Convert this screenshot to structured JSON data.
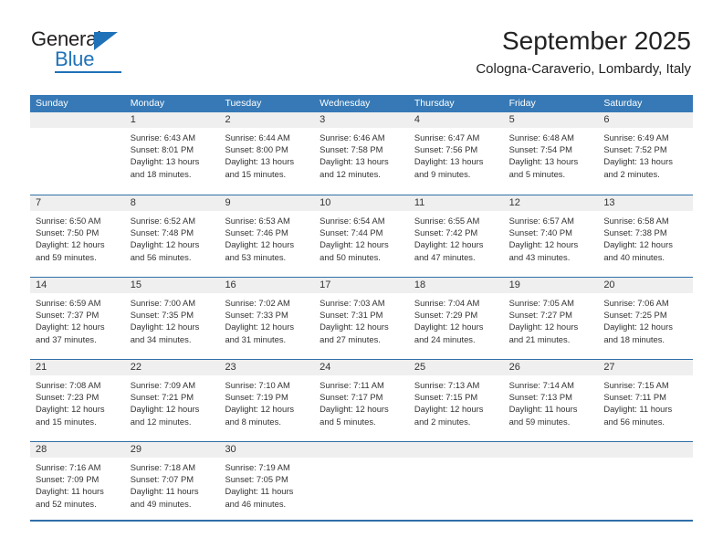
{
  "branding": {
    "logo_text_1": "General",
    "logo_text_2": "Blue",
    "accent_color": "#1f72b8"
  },
  "header": {
    "month_title": "September 2025",
    "location": "Cologna-Caraverio, Lombardy, Italy",
    "header_bg_color": "#3679b6",
    "day_band_color": "#efefef"
  },
  "weekdays": [
    "Sunday",
    "Monday",
    "Tuesday",
    "Wednesday",
    "Thursday",
    "Friday",
    "Saturday"
  ],
  "weeks": [
    [
      {
        "day": "",
        "lines": []
      },
      {
        "day": "1",
        "lines": [
          "Sunrise: 6:43 AM",
          "Sunset: 8:01 PM",
          "Daylight: 13 hours",
          "and 18 minutes."
        ]
      },
      {
        "day": "2",
        "lines": [
          "Sunrise: 6:44 AM",
          "Sunset: 8:00 PM",
          "Daylight: 13 hours",
          "and 15 minutes."
        ]
      },
      {
        "day": "3",
        "lines": [
          "Sunrise: 6:46 AM",
          "Sunset: 7:58 PM",
          "Daylight: 13 hours",
          "and 12 minutes."
        ]
      },
      {
        "day": "4",
        "lines": [
          "Sunrise: 6:47 AM",
          "Sunset: 7:56 PM",
          "Daylight: 13 hours",
          "and 9 minutes."
        ]
      },
      {
        "day": "5",
        "lines": [
          "Sunrise: 6:48 AM",
          "Sunset: 7:54 PM",
          "Daylight: 13 hours",
          "and 5 minutes."
        ]
      },
      {
        "day": "6",
        "lines": [
          "Sunrise: 6:49 AM",
          "Sunset: 7:52 PM",
          "Daylight: 13 hours",
          "and 2 minutes."
        ]
      }
    ],
    [
      {
        "day": "7",
        "lines": [
          "Sunrise: 6:50 AM",
          "Sunset: 7:50 PM",
          "Daylight: 12 hours",
          "and 59 minutes."
        ]
      },
      {
        "day": "8",
        "lines": [
          "Sunrise: 6:52 AM",
          "Sunset: 7:48 PM",
          "Daylight: 12 hours",
          "and 56 minutes."
        ]
      },
      {
        "day": "9",
        "lines": [
          "Sunrise: 6:53 AM",
          "Sunset: 7:46 PM",
          "Daylight: 12 hours",
          "and 53 minutes."
        ]
      },
      {
        "day": "10",
        "lines": [
          "Sunrise: 6:54 AM",
          "Sunset: 7:44 PM",
          "Daylight: 12 hours",
          "and 50 minutes."
        ]
      },
      {
        "day": "11",
        "lines": [
          "Sunrise: 6:55 AM",
          "Sunset: 7:42 PM",
          "Daylight: 12 hours",
          "and 47 minutes."
        ]
      },
      {
        "day": "12",
        "lines": [
          "Sunrise: 6:57 AM",
          "Sunset: 7:40 PM",
          "Daylight: 12 hours",
          "and 43 minutes."
        ]
      },
      {
        "day": "13",
        "lines": [
          "Sunrise: 6:58 AM",
          "Sunset: 7:38 PM",
          "Daylight: 12 hours",
          "and 40 minutes."
        ]
      }
    ],
    [
      {
        "day": "14",
        "lines": [
          "Sunrise: 6:59 AM",
          "Sunset: 7:37 PM",
          "Daylight: 12 hours",
          "and 37 minutes."
        ]
      },
      {
        "day": "15",
        "lines": [
          "Sunrise: 7:00 AM",
          "Sunset: 7:35 PM",
          "Daylight: 12 hours",
          "and 34 minutes."
        ]
      },
      {
        "day": "16",
        "lines": [
          "Sunrise: 7:02 AM",
          "Sunset: 7:33 PM",
          "Daylight: 12 hours",
          "and 31 minutes."
        ]
      },
      {
        "day": "17",
        "lines": [
          "Sunrise: 7:03 AM",
          "Sunset: 7:31 PM",
          "Daylight: 12 hours",
          "and 27 minutes."
        ]
      },
      {
        "day": "18",
        "lines": [
          "Sunrise: 7:04 AM",
          "Sunset: 7:29 PM",
          "Daylight: 12 hours",
          "and 24 minutes."
        ]
      },
      {
        "day": "19",
        "lines": [
          "Sunrise: 7:05 AM",
          "Sunset: 7:27 PM",
          "Daylight: 12 hours",
          "and 21 minutes."
        ]
      },
      {
        "day": "20",
        "lines": [
          "Sunrise: 7:06 AM",
          "Sunset: 7:25 PM",
          "Daylight: 12 hours",
          "and 18 minutes."
        ]
      }
    ],
    [
      {
        "day": "21",
        "lines": [
          "Sunrise: 7:08 AM",
          "Sunset: 7:23 PM",
          "Daylight: 12 hours",
          "and 15 minutes."
        ]
      },
      {
        "day": "22",
        "lines": [
          "Sunrise: 7:09 AM",
          "Sunset: 7:21 PM",
          "Daylight: 12 hours",
          "and 12 minutes."
        ]
      },
      {
        "day": "23",
        "lines": [
          "Sunrise: 7:10 AM",
          "Sunset: 7:19 PM",
          "Daylight: 12 hours",
          "and 8 minutes."
        ]
      },
      {
        "day": "24",
        "lines": [
          "Sunrise: 7:11 AM",
          "Sunset: 7:17 PM",
          "Daylight: 12 hours",
          "and 5 minutes."
        ]
      },
      {
        "day": "25",
        "lines": [
          "Sunrise: 7:13 AM",
          "Sunset: 7:15 PM",
          "Daylight: 12 hours",
          "and 2 minutes."
        ]
      },
      {
        "day": "26",
        "lines": [
          "Sunrise: 7:14 AM",
          "Sunset: 7:13 PM",
          "Daylight: 11 hours",
          "and 59 minutes."
        ]
      },
      {
        "day": "27",
        "lines": [
          "Sunrise: 7:15 AM",
          "Sunset: 7:11 PM",
          "Daylight: 11 hours",
          "and 56 minutes."
        ]
      }
    ],
    [
      {
        "day": "28",
        "lines": [
          "Sunrise: 7:16 AM",
          "Sunset: 7:09 PM",
          "Daylight: 11 hours",
          "and 52 minutes."
        ]
      },
      {
        "day": "29",
        "lines": [
          "Sunrise: 7:18 AM",
          "Sunset: 7:07 PM",
          "Daylight: 11 hours",
          "and 49 minutes."
        ]
      },
      {
        "day": "30",
        "lines": [
          "Sunrise: 7:19 AM",
          "Sunset: 7:05 PM",
          "Daylight: 11 hours",
          "and 46 minutes."
        ]
      },
      {
        "day": "",
        "lines": []
      },
      {
        "day": "",
        "lines": []
      },
      {
        "day": "",
        "lines": []
      },
      {
        "day": "",
        "lines": []
      }
    ]
  ]
}
